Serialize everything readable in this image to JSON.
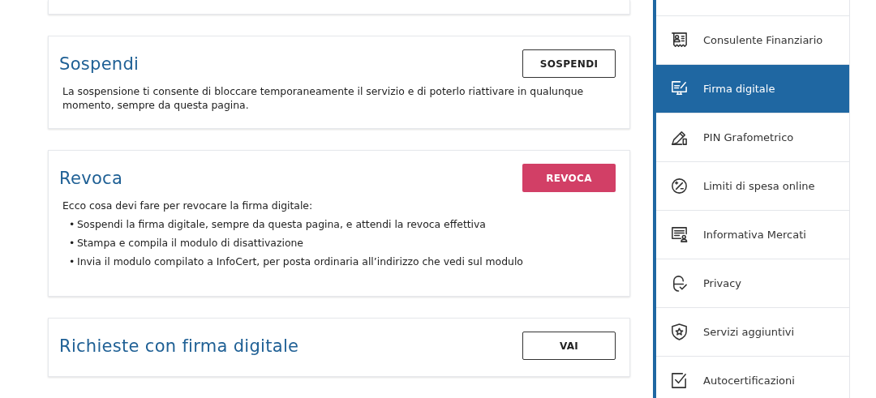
{
  "cards": [
    {
      "title": "Sospendi",
      "button": {
        "label": "SOSPENDI",
        "kind": "outline"
      },
      "text": "La sospensione ti consente di bloccare temporaneamente il servizio e di poterlo riattivare in qualunque momento, sempre da questa pagina."
    },
    {
      "title": "Revoca",
      "button": {
        "label": "REVOCA",
        "kind": "danger"
      },
      "text": "Ecco cosa devi fare per revocare la firma digitale:",
      "bullets": [
        {
          "marker": "•",
          "text": "Sospendi la firma digitale, sempre da questa pagina, e attendi la revoca effettiva"
        },
        {
          "marker": "•",
          "text": "Stampa e compila il modulo di disattivazione"
        },
        {
          "marker": "•",
          "text": "Invia il modulo compilato a InfoCert, per posta ordinaria all’indirizzo che vedi sul modulo"
        }
      ]
    },
    {
      "title": "Richieste con firma digitale",
      "button": {
        "label": "VAI",
        "kind": "outline"
      }
    }
  ],
  "sidebar": {
    "items": [
      {
        "label": "Consulente Finanziario",
        "selected": false
      },
      {
        "label": "Firma digitale",
        "selected": true
      },
      {
        "label": "PIN Grafometrico",
        "selected": false
      },
      {
        "label": "Limiti di spesa online",
        "selected": false
      },
      {
        "label": "Informativa Mercati",
        "selected": false
      },
      {
        "label": "Privacy",
        "selected": false
      },
      {
        "label": "Servizi aggiuntivi",
        "selected": false
      },
      {
        "label": "Autocertificazioni",
        "selected": false
      }
    ]
  }
}
